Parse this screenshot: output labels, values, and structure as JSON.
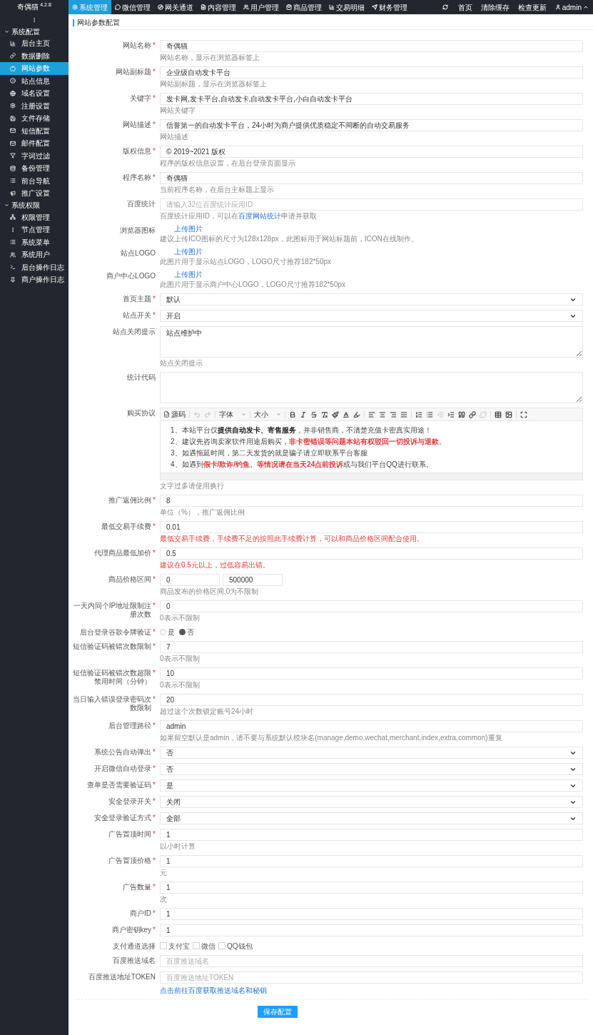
{
  "app": {
    "name": "奇偶猫",
    "version": "4.2.8"
  },
  "top_nav": [
    {
      "label": "系统管理",
      "selected": true
    },
    {
      "label": "微信管理",
      "selected": false
    },
    {
      "label": "网关通道",
      "selected": false
    },
    {
      "label": "内容管理",
      "selected": false
    },
    {
      "label": "用户管理",
      "selected": false
    },
    {
      "label": "商品管理",
      "selected": false
    },
    {
      "label": "交易明细",
      "selected": false
    },
    {
      "label": "财务管理",
      "selected": false
    }
  ],
  "top_links": [
    "首页",
    "清除缓存",
    "检查更新"
  ],
  "user": "admin",
  "sidebar": [
    {
      "title": "系统配置",
      "expanded": true,
      "items": [
        {
          "label": "后台主页",
          "selected": false
        },
        {
          "label": "数据删除",
          "selected": false
        },
        {
          "label": "网站参数",
          "selected": true
        },
        {
          "label": "站点信息",
          "selected": false
        },
        {
          "label": "域名设置",
          "selected": false
        },
        {
          "label": "注册设置",
          "selected": false
        },
        {
          "label": "文件存储",
          "selected": false
        },
        {
          "label": "短信配置",
          "selected": false
        },
        {
          "label": "邮件配置",
          "selected": false
        },
        {
          "label": "字词过滤",
          "selected": false
        },
        {
          "label": "备份管理",
          "selected": false
        },
        {
          "label": "前台导航",
          "selected": false
        },
        {
          "label": "推广设置",
          "selected": false
        }
      ]
    },
    {
      "title": "系统权限",
      "expanded": true,
      "items": [
        {
          "label": "权限管理",
          "selected": false
        },
        {
          "label": "节点管理",
          "selected": false
        },
        {
          "label": "系统菜单",
          "selected": false
        },
        {
          "label": "系统用户",
          "selected": false
        },
        {
          "label": "后台操作日志",
          "selected": false
        },
        {
          "label": "商户操作日志",
          "selected": false
        }
      ]
    }
  ],
  "page_title": "网站参数配置",
  "fields": [
    {
      "kind": "text",
      "label": "网站名称",
      "required_mark": "*",
      "value": "奇偶猫",
      "help": [
        {
          "text": "网站名称，显示在浏览器标签上",
          "kind": "plain"
        }
      ]
    },
    {
      "kind": "text",
      "label": "网站副标题",
      "required_mark": "*",
      "value": "企业级自动发卡平台",
      "help": [
        {
          "text": "网站副标题，显示在浏览器标签上",
          "kind": "plain"
        }
      ]
    },
    {
      "kind": "text",
      "label": "关键字",
      "required_mark": "*",
      "value": "发卡网,发卡平台,自动发卡,自动发卡平台,小白自动发卡平台",
      "help": [
        {
          "text": "网站关键字",
          "kind": "plain"
        }
      ]
    },
    {
      "kind": "text",
      "label": "网站描述",
      "required_mark": "*",
      "value": "信誉第一的自动发卡平台，24小时为商户提供优质稳定不间断的自动交易服务",
      "help": [
        {
          "text": "网站描述",
          "kind": "plain"
        }
      ]
    },
    {
      "kind": "text",
      "label": "版权信息",
      "required_mark": "*",
      "value": "© 2019~2021 版权",
      "help": [
        {
          "text": "程序的版权信息设置，在后台登录页面显示",
          "kind": "plain"
        }
      ]
    },
    {
      "kind": "text",
      "label": "程序名称",
      "required_mark": "*",
      "value": "奇偶猫",
      "help": [
        {
          "text": "当前程序名称，在后台主标题上显示",
          "kind": "plain"
        }
      ]
    },
    {
      "kind": "text",
      "label": "百度统计",
      "placeholder": "请输入32位百度统计应用ID",
      "help": [
        {
          "text": "百度统计应用ID，可以在",
          "kind": "plain"
        },
        {
          "text": "百度网站统计",
          "kind": "link"
        },
        {
          "text": "申请并获取",
          "kind": "plain"
        }
      ]
    },
    {
      "kind": "upload",
      "label": "浏览器图标",
      "link": "上传图片",
      "help": [
        {
          "text": "建议上传ICO图标的尺寸为128x128px，此图标用于网站标题前，ICON在线制作。",
          "kind": "plain"
        }
      ]
    },
    {
      "kind": "upload",
      "label": "站点LOGO",
      "link": "上传图片",
      "help": [
        {
          "text": "此图片用于显示站点LOGO，LOGO尺寸推荐182*50px",
          "kind": "plain"
        }
      ]
    },
    {
      "kind": "upload",
      "label": "商户中心LOGO",
      "link": "上传图片",
      "help": [
        {
          "text": "此图片用于显示商户中心LOGO，LOGO尺寸推荐182*50px",
          "kind": "plain"
        }
      ]
    },
    {
      "kind": "select",
      "label": "首页主题",
      "required_mark": "*",
      "value": "默认"
    },
    {
      "kind": "select",
      "label": "站点开关",
      "required_mark": "*",
      "value": "开启"
    },
    {
      "kind": "textarea",
      "label": "站点关闭提示",
      "value": "站点维护中",
      "help": [
        {
          "text": "站点关闭提示",
          "kind": "plain"
        }
      ]
    },
    {
      "kind": "textarea",
      "label": "统计代码"
    },
    {
      "kind": "editor",
      "label": "购买协议",
      "help": [
        {
          "text": "文字过多请使用换行",
          "kind": "plain"
        }
      ],
      "tools": [
        {
          "kind": "source",
          "label": "源码",
          "disabled": false
        },
        {
          "kind": "separator"
        },
        {
          "kind": "undo",
          "disabled": true
        },
        {
          "kind": "redo",
          "disabled": true
        },
        {
          "kind": "separator"
        },
        {
          "kind": "dropdown",
          "label": "字体",
          "disabled": false
        },
        {
          "kind": "separator"
        },
        {
          "kind": "dropdown",
          "label": "大小",
          "disabled": false
        },
        {
          "kind": "separator"
        },
        {
          "kind": "bold",
          "disabled": false
        },
        {
          "kind": "italic",
          "disabled": false
        },
        {
          "kind": "strike",
          "disabled": false
        },
        {
          "kind": "clear",
          "disabled": false
        },
        {
          "kind": "brush",
          "disabled": false
        },
        {
          "kind": "color",
          "disabled": false
        },
        {
          "kind": "highlight",
          "disabled": false
        },
        {
          "kind": "separator"
        },
        {
          "kind": "align_left",
          "disabled": false
        },
        {
          "kind": "align_center",
          "disabled": false
        },
        {
          "kind": "align_right",
          "disabled": false
        },
        {
          "kind": "justify",
          "disabled": false
        },
        {
          "kind": "separator"
        },
        {
          "kind": "ordered",
          "disabled": false
        },
        {
          "kind": "bullets",
          "disabled": false
        },
        {
          "kind": "outdent",
          "disabled": true
        },
        {
          "kind": "indent",
          "disabled": false
        },
        {
          "kind": "quote",
          "disabled": false
        },
        {
          "kind": "link",
          "disabled": false
        },
        {
          "kind": "unlink",
          "disabled": true
        },
        {
          "kind": "separator"
        },
        {
          "kind": "table",
          "disabled": false
        },
        {
          "kind": "image",
          "disabled": false
        },
        {
          "kind": "separator"
        },
        {
          "kind": "fullscreen",
          "disabled": false
        }
      ],
      "paragraphs": [
        [
          {
            "text": "1、本站平台仅",
            "kind": "plain"
          },
          {
            "text": "提供自动发卡、寄售服务",
            "kind": "emphasis"
          },
          {
            "text": "，并非销售商，不清楚充值卡密真实用途！",
            "kind": "plain"
          }
        ],
        [
          {
            "text": "2、建议先咨询卖家软件用途后购买，",
            "kind": "plain"
          },
          {
            "text": "非卡密错误等问题本站有权驳回一切投诉与退款",
            "kind": "warning"
          },
          {
            "text": "。",
            "kind": "plain"
          }
        ],
        [
          {
            "text": "3、如遇拖延时间，第二天发货的就是骗子请立即联系平台客服",
            "kind": "plain"
          }
        ],
        [
          {
            "text": "4、如遇到",
            "kind": "plain"
          },
          {
            "text": "假卡/欺诈/钓鱼、等情况请在当天24点前投诉",
            "kind": "warning"
          },
          {
            "text": "或与我们平台QQ进行联系。",
            "kind": "plain"
          }
        ]
      ]
    },
    {
      "kind": "text",
      "label": "推广返佣比例",
      "required_mark": "*",
      "value": "8",
      "help": [
        {
          "text": "单位（%），推广返佣比例",
          "kind": "plain"
        }
      ]
    },
    {
      "kind": "text",
      "label": "最低交易手续费",
      "required_mark": "*",
      "value": "0.01",
      "help": [
        {
          "text": "最低交易手续费，手续费不足的按照此手续费计算，可以和商品价格区间配合使用。",
          "kind": "warning"
        }
      ]
    },
    {
      "kind": "text",
      "label": "代理商品最低加价",
      "required_mark": "*",
      "value": "0.5",
      "help": [
        {
          "text": "建议在0.5元以上，过低容易出错。",
          "kind": "warning"
        }
      ]
    },
    {
      "kind": "range",
      "label": "商品价格区间",
      "required_mark": "*",
      "values": [
        "0",
        "500000"
      ],
      "help": [
        {
          "text": "商品发布的价格区间,0为不限制",
          "kind": "plain"
        }
      ]
    },
    {
      "kind": "text",
      "label": "一天内同个IP地址限制注册次数",
      "required_mark": "*",
      "value": "0",
      "help": [
        {
          "text": "0表示不限制",
          "kind": "plain"
        }
      ]
    },
    {
      "kind": "radio",
      "label": "后台登录谷歌令牌验证",
      "required_mark": "*",
      "options": [
        {
          "label": "是",
          "selected": false
        },
        {
          "label": "否",
          "selected": true
        }
      ]
    },
    {
      "kind": "text",
      "label": "短信验证码被错次数限制",
      "required_mark": "*",
      "value": "7",
      "help": [
        {
          "text": "0表示不限制",
          "kind": "plain"
        }
      ]
    },
    {
      "kind": "text",
      "label": "短信验证码被错次数超限禁用时间（分钟）",
      "required_mark": "*",
      "value": "10",
      "help": [
        {
          "text": "0表示不限制",
          "kind": "plain"
        }
      ]
    },
    {
      "kind": "text",
      "label": "当日输入错误登录密码次数限制",
      "required_mark": "*",
      "value": "20",
      "help": [
        {
          "text": "超过这个次数锁定账号24小时",
          "kind": "plain"
        }
      ]
    },
    {
      "kind": "text",
      "label": "后台管理路径",
      "required_mark": "*",
      "value": "admin",
      "help": [
        {
          "text": "如果留空默认是admin，请不要与系统默认模块名(manage,demo,wechat,merchant,index,extra,common)重复",
          "kind": "plain"
        }
      ]
    },
    {
      "kind": "select",
      "label": "系统公告自动弹出",
      "required_mark": "*",
      "value": "否"
    },
    {
      "kind": "select",
      "label": "开启微信自动登录",
      "required_mark": "*",
      "value": "否"
    },
    {
      "kind": "select",
      "label": "查单是否需要验证码",
      "required_mark": "*",
      "value": "是"
    },
    {
      "kind": "select",
      "label": "安全登录开关",
      "required_mark": "*",
      "value": "关闭"
    },
    {
      "kind": "select",
      "label": "安全登录验证方式",
      "required_mark": "*",
      "value": "全部"
    },
    {
      "kind": "text",
      "label": "广告置顶时间",
      "required_mark": "*",
      "value": "1",
      "help": [
        {
          "text": "以小时计算",
          "kind": "plain"
        }
      ]
    },
    {
      "kind": "text",
      "label": "广告置顶价格",
      "required_mark": "*",
      "value": "1",
      "help": [
        {
          "text": "元",
          "kind": "plain"
        }
      ]
    },
    {
      "kind": "text",
      "label": "广告数量",
      "required_mark": "*",
      "value": "1",
      "help": [
        {
          "text": "次",
          "kind": "plain"
        }
      ]
    },
    {
      "kind": "text",
      "label": "商户ID",
      "required_mark": "*",
      "value": "1"
    },
    {
      "kind": "text",
      "label": "商户密钥key",
      "required_mark": "*",
      "value": "1"
    },
    {
      "kind": "checkbox",
      "label": "支付通道选择",
      "options": [
        {
          "label": "支付宝",
          "checked": false
        },
        {
          "label": "微信",
          "checked": false
        },
        {
          "label": "QQ钱包",
          "checked": false
        }
      ]
    },
    {
      "kind": "text",
      "label": "百度推送域名",
      "placeholder": "百度推送域名"
    },
    {
      "kind": "text",
      "label": "百度推送地址TOKEN",
      "placeholder": "百度推送地址TOKEN",
      "help": [
        {
          "text": "点击前往百度获取推送域名和秘钥",
          "kind": "link"
        }
      ]
    }
  ],
  "save_button": "保存配置"
}
